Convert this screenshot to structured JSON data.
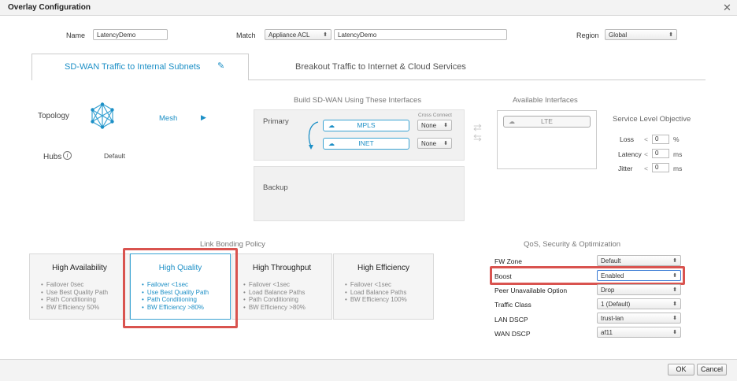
{
  "window": {
    "title": "Overlay Configuration",
    "close_icon": "close-icon"
  },
  "header": {
    "name_label": "Name",
    "name_value": "LatencyDemo",
    "match_label": "Match",
    "match_type": "Appliance ACL",
    "match_value": "LatencyDemo",
    "region_label": "Region",
    "region_value": "Global"
  },
  "tabs": [
    {
      "label": "SD-WAN Traffic to Internal Subnets",
      "active": true
    },
    {
      "label": "Breakout Traffic to Internet & Cloud Services",
      "active": false
    }
  ],
  "topology": {
    "label": "Topology",
    "value": "Mesh",
    "hubs_label": "Hubs",
    "hubs_value": "Default",
    "icon": "mesh-topology-icon"
  },
  "interfaces": {
    "build_title": "Build SD-WAN Using These Interfaces",
    "available_title": "Available Interfaces",
    "primary_label": "Primary",
    "backup_label": "Backup",
    "cross_connect_label": "Cross Connect",
    "primary_items": [
      {
        "name": "MPLS",
        "cross_connect": "None"
      },
      {
        "name": "INET",
        "cross_connect": "None"
      }
    ],
    "available_items": [
      "LTE"
    ]
  },
  "slo": {
    "title": "Service Level Objective",
    "loss": {
      "label": "Loss",
      "op": "<",
      "value": "0",
      "unit": "%"
    },
    "latency": {
      "label": "Latency",
      "op": "<",
      "value": "0",
      "unit": "ms"
    },
    "jitter": {
      "label": "Jitter",
      "op": "<",
      "value": "0",
      "unit": "ms"
    }
  },
  "bonding": {
    "title": "Link Bonding Policy",
    "cards": [
      {
        "title": "High Availability",
        "items": [
          "Failover 0sec",
          "Use Best Quality Path",
          "Path Conditioning",
          "BW Efficiency 50%"
        ],
        "selected": false
      },
      {
        "title": "High Quality",
        "items": [
          "Failover <1sec",
          "Use Best Quality Path",
          "Path Conditioning",
          "BW Efficiency >80%"
        ],
        "selected": true
      },
      {
        "title": "High Throughput",
        "items": [
          "Failover <1sec",
          "Load Balance Paths",
          "Path Conditioning",
          "BW Efficiency >80%"
        ],
        "selected": false
      },
      {
        "title": "High Efficiency",
        "items": [
          "Failover <1sec",
          "Load Balance Paths",
          "BW Efficiency 100%"
        ],
        "selected": false
      }
    ]
  },
  "qos": {
    "title": "QoS, Security & Optimization",
    "rows": [
      {
        "label": "FW Zone",
        "value": "Default"
      },
      {
        "label": "Boost",
        "value": "Enabled"
      },
      {
        "label": "Peer Unavailable Option",
        "value": "Drop"
      },
      {
        "label": "Traffic Class",
        "value": "1 (Default)"
      },
      {
        "label": "LAN DSCP",
        "value": "trust-lan"
      },
      {
        "label": "WAN DSCP",
        "value": "af11"
      }
    ]
  },
  "footer": {
    "ok_label": "OK",
    "cancel_label": "Cancel"
  },
  "colors": {
    "accent": "#1c8fc6",
    "highlight": "#d9534f"
  }
}
